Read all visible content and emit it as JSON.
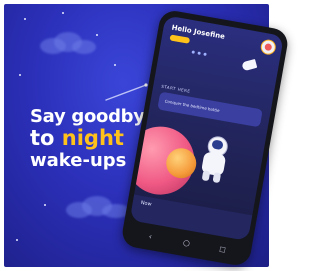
{
  "headline": {
    "line1": "Say goodbye",
    "line2_prefix": "to",
    "line2_accent": "night",
    "line3": "wake-ups"
  },
  "phone": {
    "app_title": "Hello Josefine",
    "section_label": "START HERE",
    "card_title": "Conquer the bedtime battle",
    "now_label": "Now",
    "nav": {
      "back_icon": "‹",
      "home_icon": "○",
      "recent_icon": "◻"
    }
  },
  "colors": {
    "background": "#2b2fb8",
    "accent": "#ffc21a",
    "text": "#ffffff"
  }
}
